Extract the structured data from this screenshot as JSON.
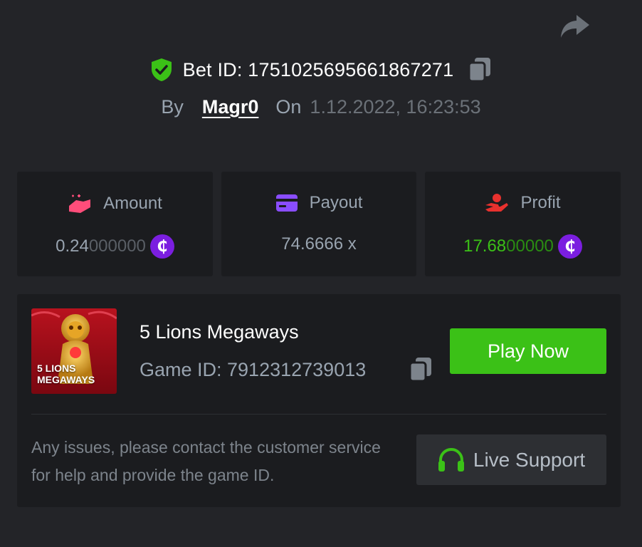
{
  "bet": {
    "id_text": "Bet ID: 1751025695661867271",
    "by_label": "By",
    "user": "Magr0",
    "on_label": "On",
    "date": "1.12.2022, 16:23:53"
  },
  "stats": {
    "amount": {
      "label": "Amount",
      "value_main": "0.24",
      "value_dim": "000000",
      "icon": "money-hand-icon"
    },
    "payout": {
      "label": "Payout",
      "value": "74.6666 x",
      "icon": "card-icon"
    },
    "profit": {
      "label": "Profit",
      "value_main": "17.68",
      "value_dim": "00000",
      "icon": "hand-coin-icon"
    }
  },
  "coin_symbol": "₵",
  "game": {
    "name": "5 Lions Megaways",
    "id_text": "Game ID: 7912312739013",
    "thumb_line1": "5 LIONS",
    "thumb_line2": "MEGAWAYS",
    "play_label": "Play Now"
  },
  "support": {
    "message": "Any issues, please contact the customer service for help and provide the game ID.",
    "button_label": "Live Support"
  },
  "colors": {
    "background": "#232428",
    "card": "#1b1c1f",
    "green": "#3bc117",
    "coin": "#7b1ee0",
    "muted": "#99a4b0"
  }
}
